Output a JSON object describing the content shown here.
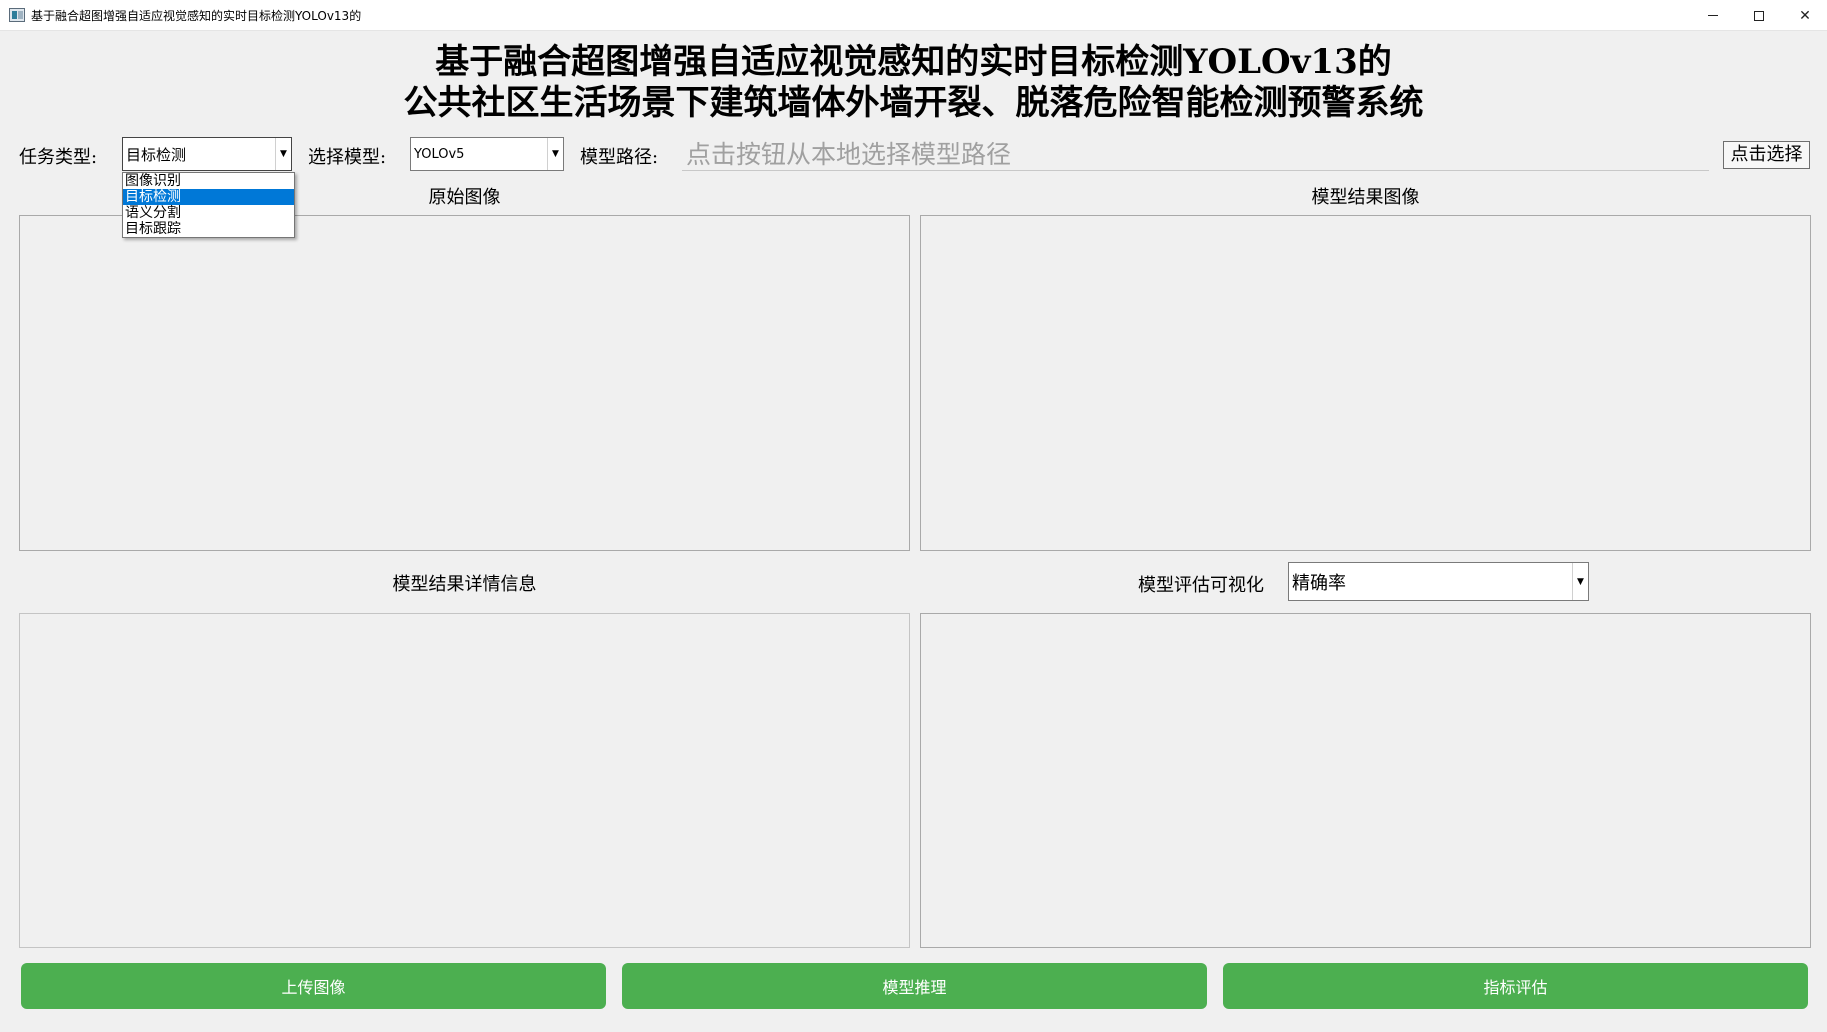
{
  "window": {
    "title": "基于融合超图增强自适应视觉感知的实时目标检测YOLOv13的",
    "minimize": "–",
    "maximize": "☐",
    "close": "✕"
  },
  "heading": {
    "line1": "基于融合超图增强自适应视觉感知的实时目标检测YOLOv13的",
    "line2": "公共社区生活场景下建筑墙体外墙开裂、脱落危险智能检测预警系统"
  },
  "controls": {
    "task_label": "任务类型:",
    "task_value": "目标检测",
    "task_options": [
      "图像识别",
      "目标检测",
      "语义分割",
      "目标跟踪"
    ],
    "model_label": "选择模型:",
    "model_value": "YOLOv5",
    "path_label": "模型路径:",
    "path_placeholder": "点击按钮从本地选择模型路径",
    "pick_button": "点击选择"
  },
  "sections": {
    "original_image": "原始图像",
    "result_image": "模型结果图像",
    "result_details": "模型结果详情信息",
    "eval_vis_label": "模型评估可视化",
    "eval_metric_value": "精确率"
  },
  "buttons": {
    "upload": "上传图像",
    "infer": "模型推理",
    "evaluate": "指标评估"
  },
  "colors": {
    "button_green": "#4caf50",
    "selection_blue": "#0078d7",
    "background": "#f0f0f0"
  }
}
